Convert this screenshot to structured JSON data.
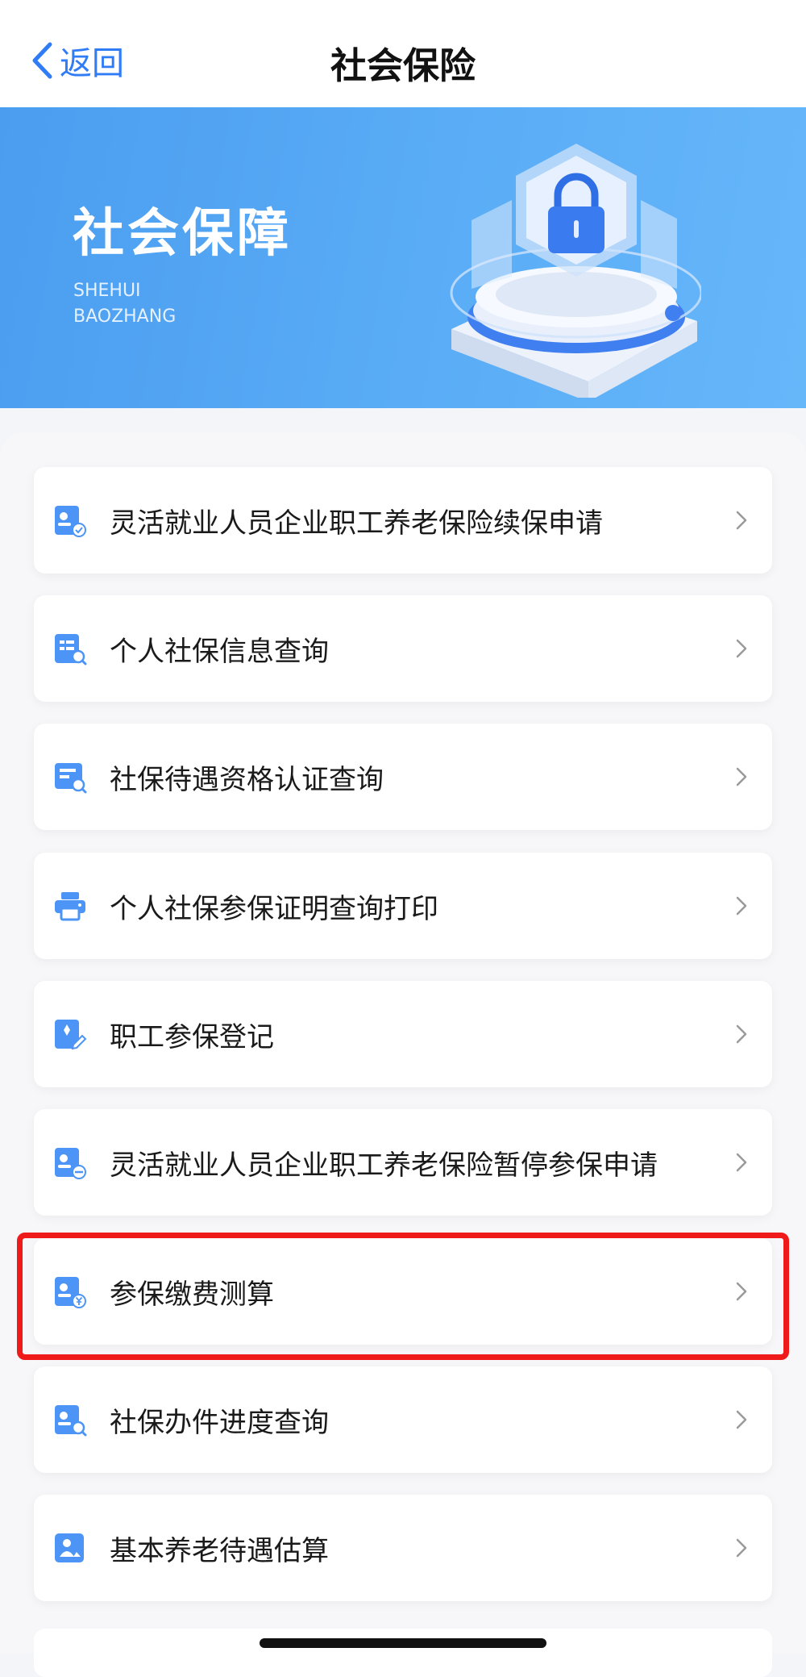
{
  "nav": {
    "back_label": "返回",
    "title": "社会保险"
  },
  "banner": {
    "title": "社会保障",
    "subtitle_line1": "SHEHUI",
    "subtitle_line2": "BAOZHANG"
  },
  "menu": {
    "items": [
      {
        "label": "灵活就业人员企业职工养老保险续保申请",
        "icon": "person-check-icon"
      },
      {
        "label": "个人社保信息查询",
        "icon": "document-search-icon"
      },
      {
        "label": "社保待遇资格认证查询",
        "icon": "card-search-icon"
      },
      {
        "label": "个人社保参保证明查询打印",
        "icon": "printer-icon"
      },
      {
        "label": "职工参保登记",
        "icon": "register-edit-icon"
      },
      {
        "label": "灵活就业人员企业职工养老保险暂停参保申请",
        "icon": "person-pause-icon"
      },
      {
        "label": "参保缴费测算",
        "icon": "person-yuan-icon"
      },
      {
        "label": "社保办件进度查询",
        "icon": "person-search-icon"
      },
      {
        "label": "基本养老待遇估算",
        "icon": "person-estimate-icon"
      }
    ],
    "highlighted": "参保缴费测算"
  },
  "colors": {
    "accent": "#2f7cf6",
    "icon_blue": "#4c94f5",
    "highlight": "#ef1b1b",
    "banner": "#55a8f4"
  }
}
